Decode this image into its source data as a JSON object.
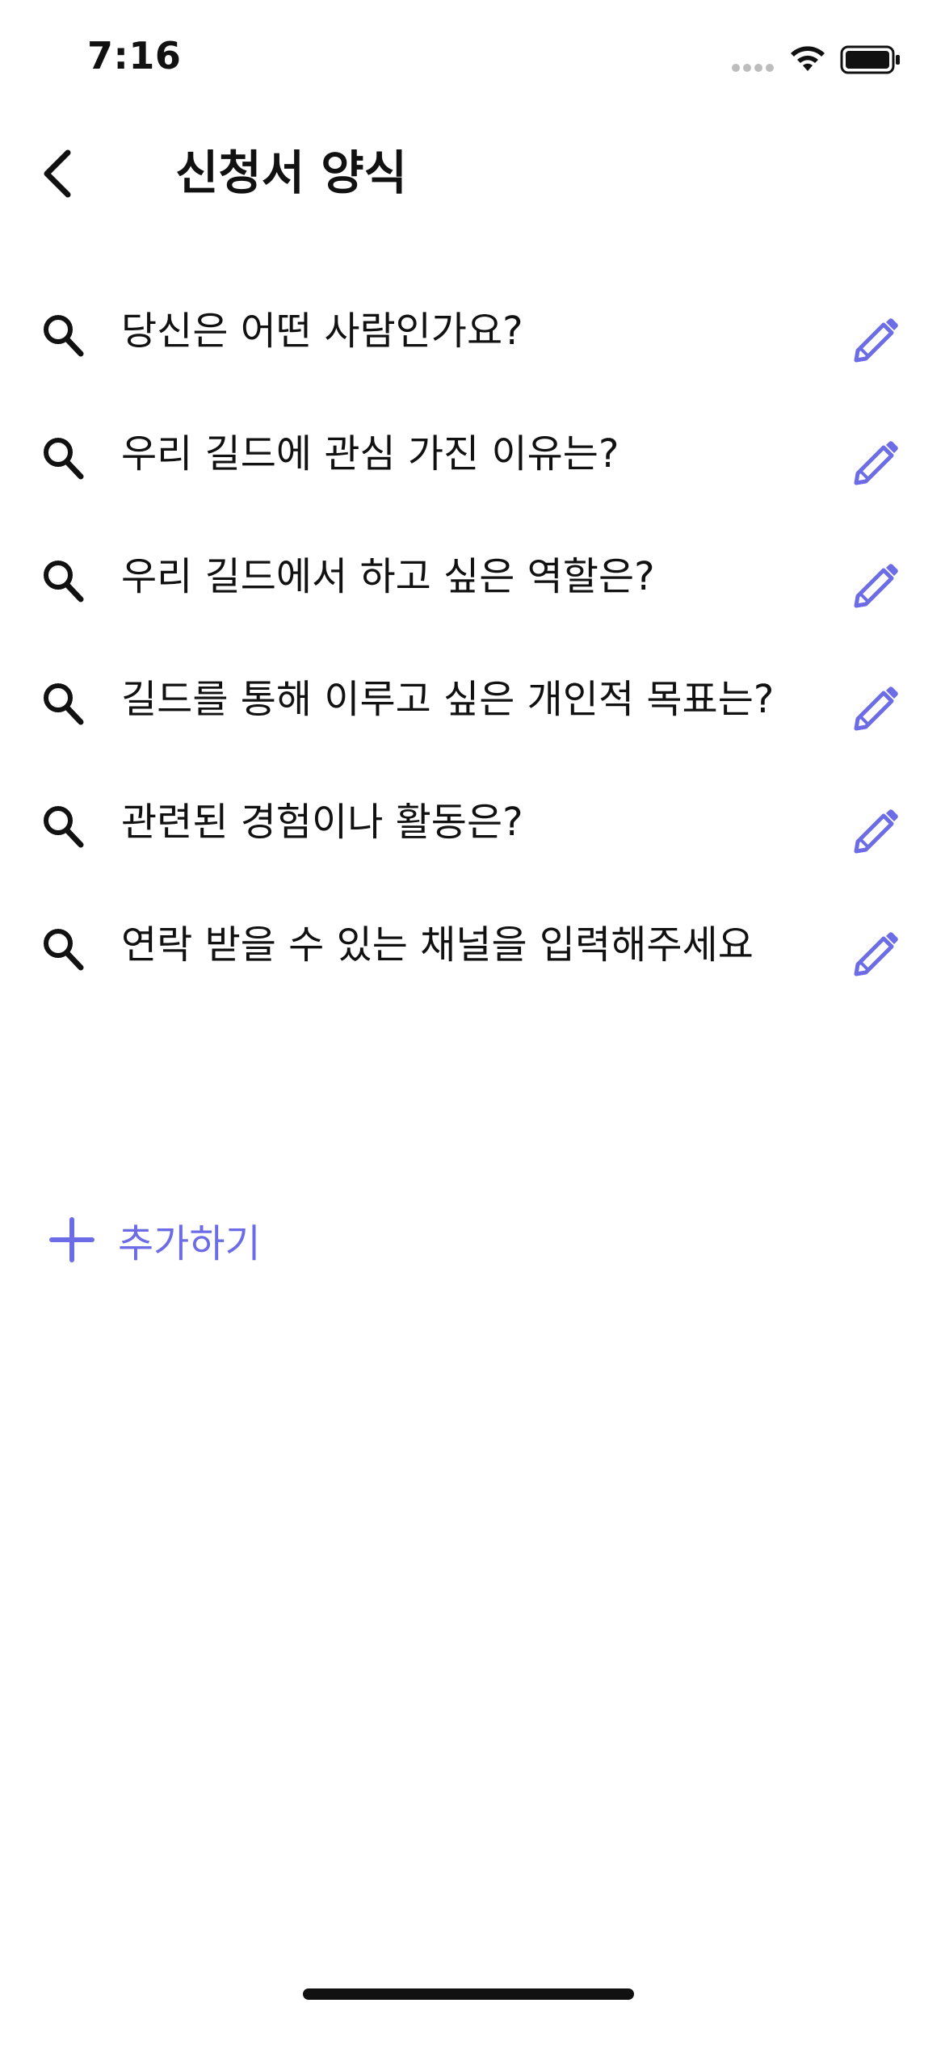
{
  "status_bar": {
    "time": "7:16",
    "signal_icon": "signal-dots-icon",
    "wifi_icon": "wifi-icon",
    "battery_icon": "battery-icon"
  },
  "header": {
    "back_icon": "chevron-left-icon",
    "title": "신청서 양식"
  },
  "questions": [
    {
      "text": "당신은 어떤 사람인가요?",
      "icon": "search-icon",
      "action_icon": "pencil-icon"
    },
    {
      "text": "우리 길드에 관심 가진 이유는?",
      "icon": "search-icon",
      "action_icon": "pencil-icon"
    },
    {
      "text": "우리 길드에서 하고 싶은 역할은?",
      "icon": "search-icon",
      "action_icon": "pencil-icon"
    },
    {
      "text": "길드를 통해 이루고 싶은 개인적 목표는?",
      "icon": "search-icon",
      "action_icon": "pencil-icon"
    },
    {
      "text": "관련된 경험이나 활동은?",
      "icon": "search-icon",
      "action_icon": "pencil-icon"
    },
    {
      "text": "연락 받을 수 있는 채널을 입력해주세요",
      "icon": "search-icon",
      "action_icon": "pencil-icon"
    }
  ],
  "add_button": {
    "icon": "plus-icon",
    "label": "추가하기"
  },
  "colors": {
    "accent": "#6c6ce6",
    "text": "#111111",
    "background": "#ffffff"
  }
}
